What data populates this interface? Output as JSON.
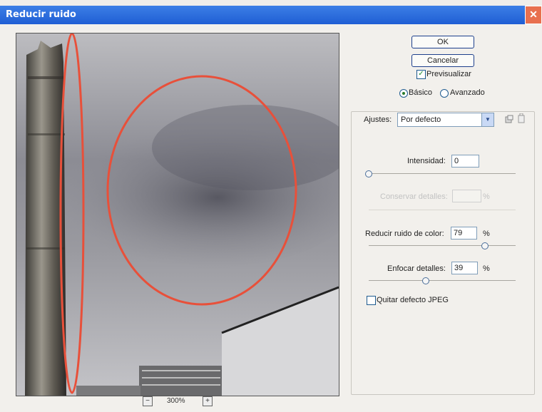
{
  "window": {
    "title": "Reducir ruido",
    "close_glyph": "✕"
  },
  "buttons": {
    "ok": "OK",
    "cancel": "Cancelar"
  },
  "preview_toggle": {
    "label": "Previsualizar",
    "checked": true
  },
  "mode": {
    "basic": "Básico",
    "advanced": "Avanzado",
    "selected": "basic"
  },
  "settings": {
    "label": "Ajustes:",
    "value": "Por defecto",
    "save_icon": "save-settings-icon",
    "delete_icon": "trash-icon"
  },
  "sliders": {
    "intensity": {
      "label": "Intensidad:",
      "value": "0",
      "unit": "",
      "level": 0.0
    },
    "preserve": {
      "label": "Conservar detalles:",
      "value": "",
      "unit": "%",
      "level": 0.0,
      "disabled": true
    },
    "color_noise": {
      "label": "Reducir ruido de color:",
      "value": "79",
      "unit": "%",
      "level": 0.79
    },
    "sharpen": {
      "label": "Enfocar detalles:",
      "value": "39",
      "unit": "%",
      "level": 0.39
    }
  },
  "jpeg": {
    "label": "Quitar defecto JPEG",
    "checked": false
  },
  "zoom": {
    "minus": "−",
    "plus": "+",
    "value": "300%"
  },
  "colors": {
    "titlebar": "#2a6ee0",
    "annotation": "#e8503a"
  }
}
